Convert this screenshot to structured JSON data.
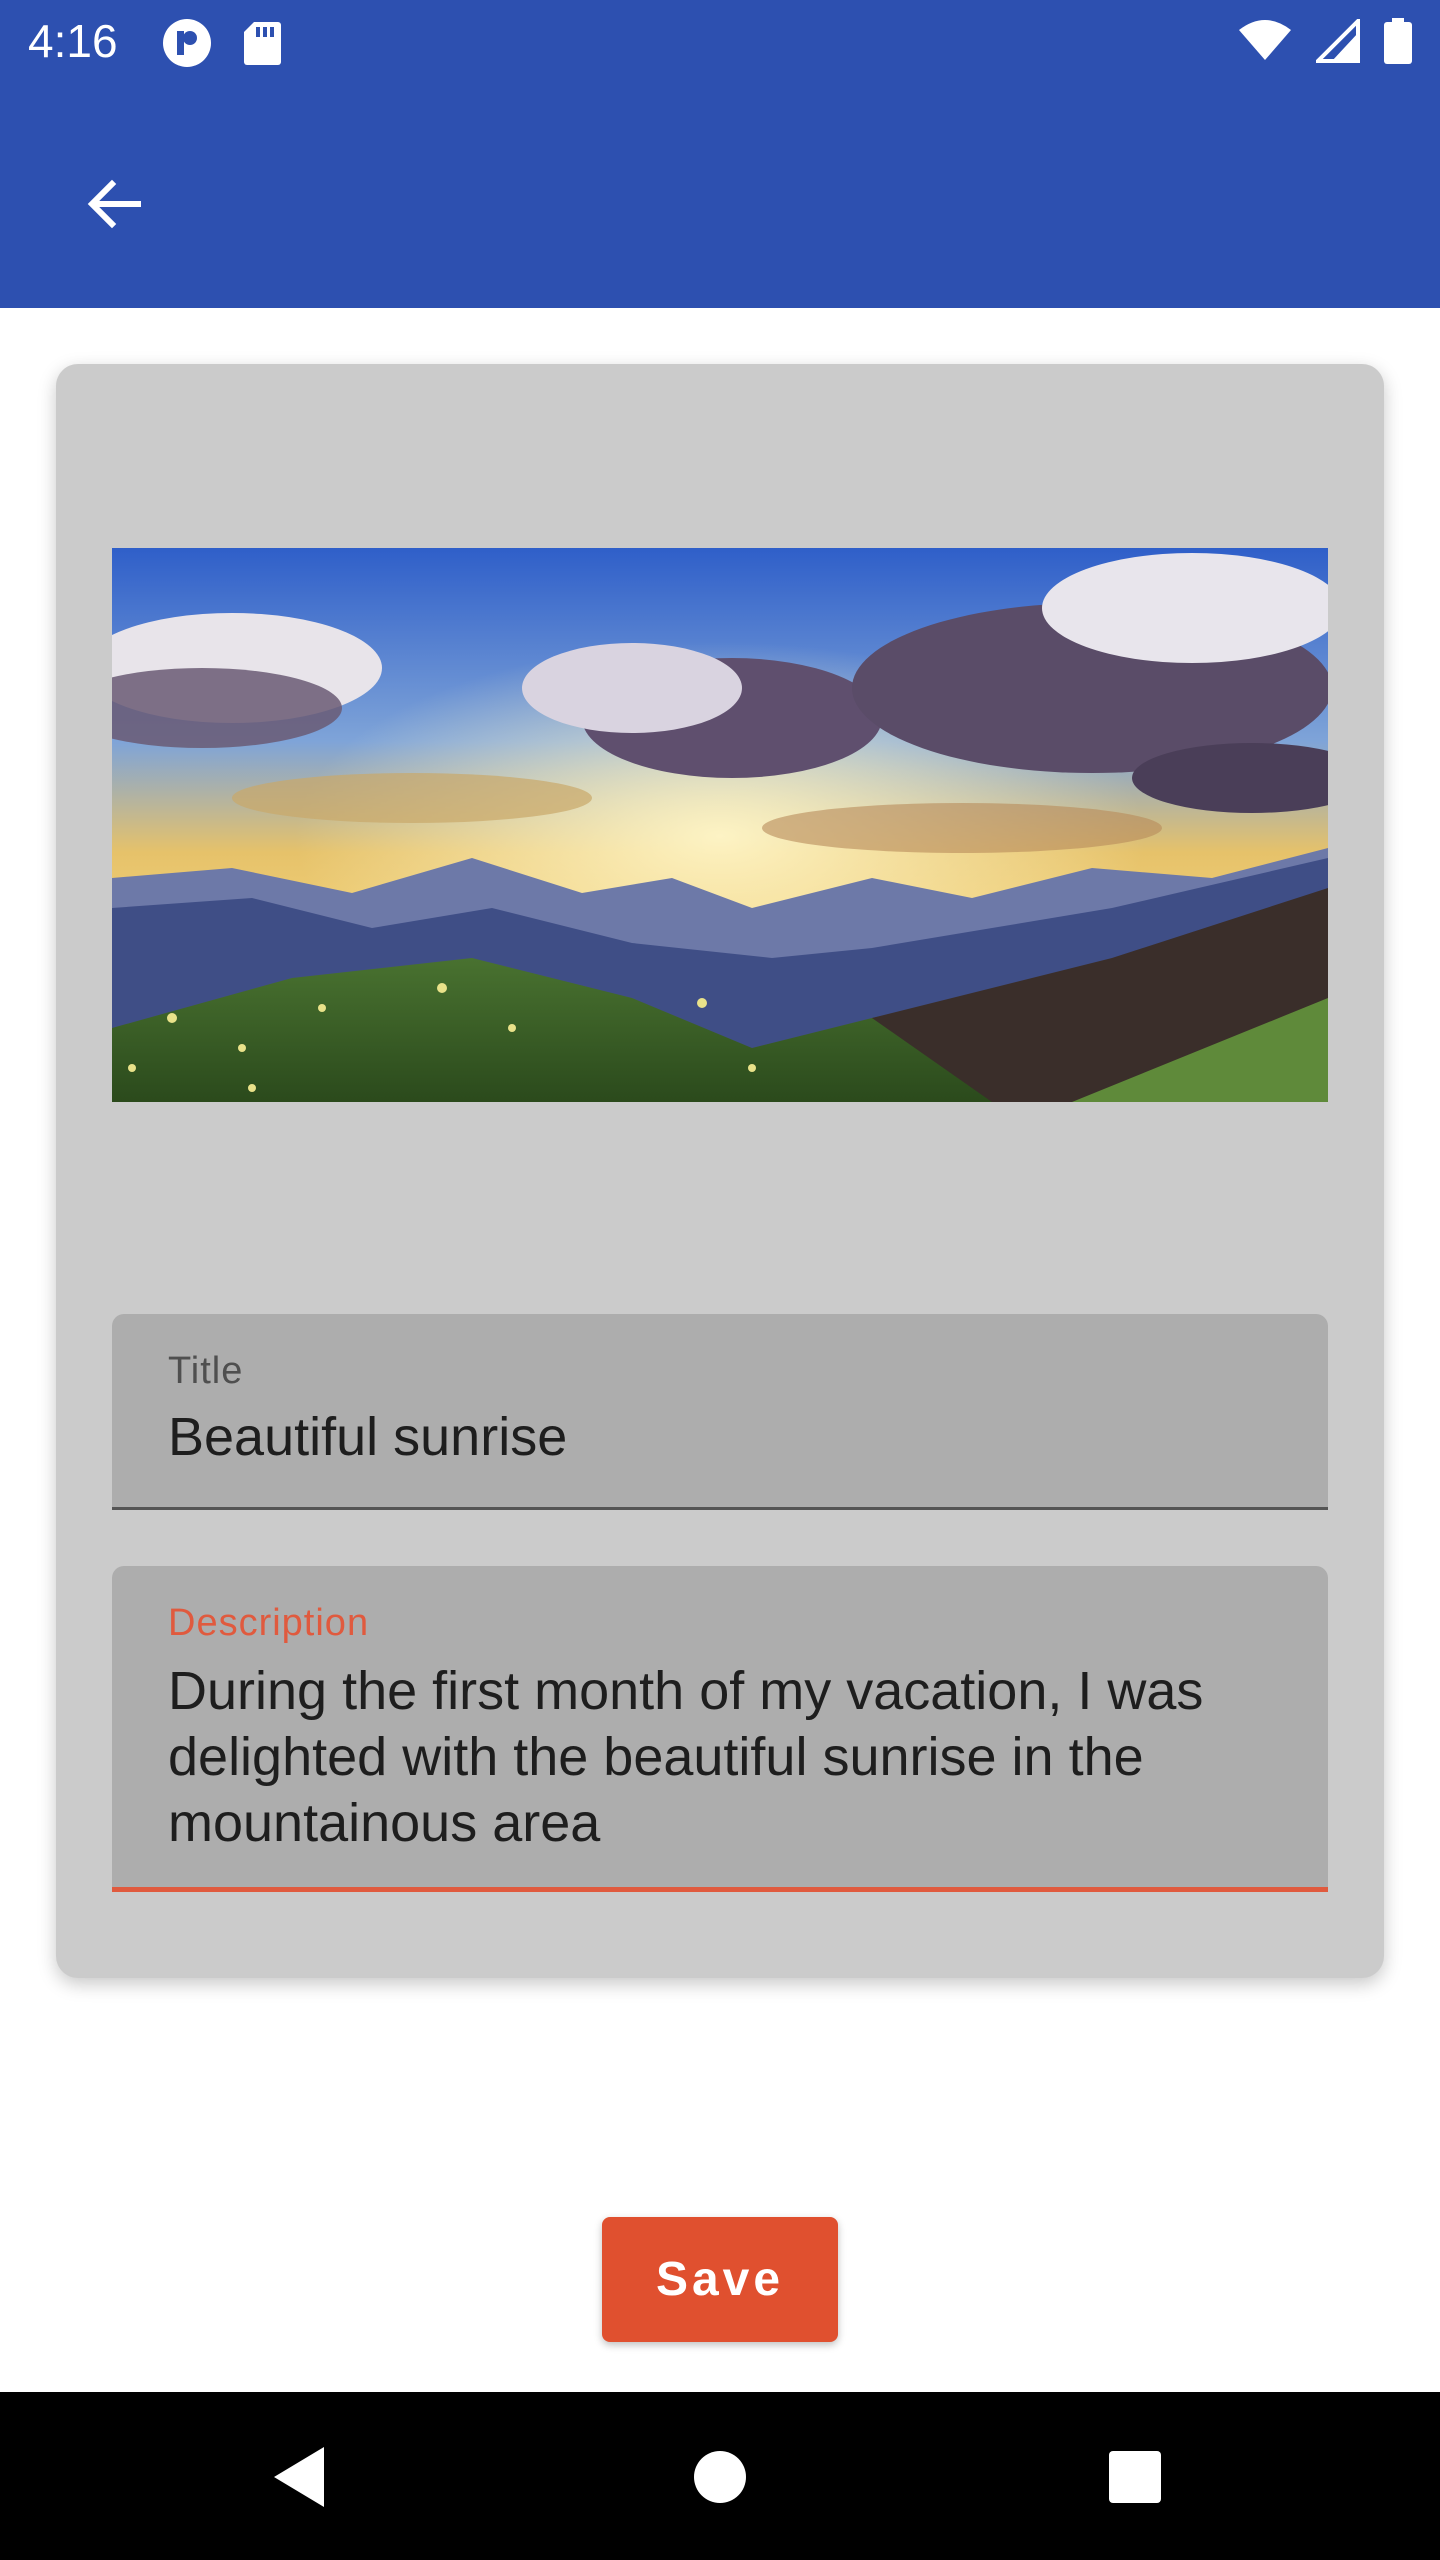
{
  "status_bar": {
    "time": "4:16",
    "icons": [
      "app-notification-icon",
      "sd-card-icon",
      "wifi-icon",
      "signal-icon",
      "battery-icon"
    ]
  },
  "app_bar": {
    "back_icon": "arrow-back-icon",
    "color": "#2d50b0"
  },
  "form": {
    "image_alt": "Sunrise over mountains",
    "title_field": {
      "label": "Title",
      "value": "Beautiful sunrise"
    },
    "description_field": {
      "label": "Description",
      "value": "During the first month of my vacation, I was delighted with the beautiful sunrise in the mountainous area"
    },
    "save_label": "Save"
  },
  "nav_bar": {
    "icons": [
      "back-triangle-icon",
      "home-circle-icon",
      "recents-square-icon"
    ]
  },
  "colors": {
    "accent": "#e0502f",
    "card": "#cbcbcb",
    "field": "#adadad"
  }
}
